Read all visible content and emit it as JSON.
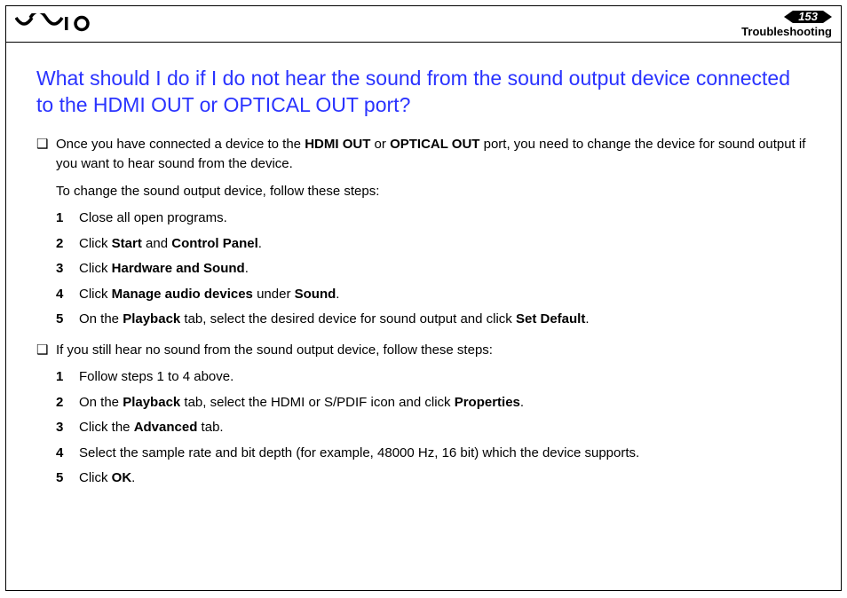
{
  "header": {
    "page_number": "153",
    "section": "Troubleshooting"
  },
  "title": "What should I do if I do not hear the sound from the sound output device connected to the HDMI OUT or OPTICAL OUT port?",
  "bullets": [
    {
      "intro_pre": "Once you have connected a device to the ",
      "bold1": "HDMI OUT",
      "mid1": " or ",
      "bold2": "OPTICAL OUT",
      "intro_post": " port, you need to change the device for sound output if you want to hear sound from the device.",
      "lead": "To change the sound output device, follow these steps:",
      "steps": [
        {
          "n": "1",
          "pre": "Close all open programs.",
          "b1": "",
          "mid": "",
          "b2": "",
          "post": ""
        },
        {
          "n": "2",
          "pre": "Click ",
          "b1": "Start",
          "mid": " and ",
          "b2": "Control Panel",
          "post": "."
        },
        {
          "n": "3",
          "pre": "Click ",
          "b1": "Hardware and Sound",
          "mid": "",
          "b2": "",
          "post": "."
        },
        {
          "n": "4",
          "pre": "Click ",
          "b1": "Manage audio devices",
          "mid": " under ",
          "b2": "Sound",
          "post": "."
        },
        {
          "n": "5",
          "pre": "On the ",
          "b1": "Playback",
          "mid": " tab, select the desired device for sound output and click ",
          "b2": "Set Default",
          "post": "."
        }
      ]
    },
    {
      "intro_pre": "If you still hear no sound from the sound output device, follow these steps:",
      "bold1": "",
      "mid1": "",
      "bold2": "",
      "intro_post": "",
      "lead": "",
      "steps": [
        {
          "n": "1",
          "pre": "Follow steps 1 to 4 above.",
          "b1": "",
          "mid": "",
          "b2": "",
          "post": ""
        },
        {
          "n": "2",
          "pre": "On the ",
          "b1": "Playback",
          "mid": " tab, select the HDMI or S/PDIF icon and click ",
          "b2": "Properties",
          "post": "."
        },
        {
          "n": "3",
          "pre": "Click the ",
          "b1": "Advanced",
          "mid": "",
          "b2": "",
          "post": " tab."
        },
        {
          "n": "4",
          "pre": "Select the sample rate and bit depth (for example, 48000 Hz, 16 bit) which the device supports.",
          "b1": "",
          "mid": "",
          "b2": "",
          "post": ""
        },
        {
          "n": "5",
          "pre": "Click ",
          "b1": "OK",
          "mid": "",
          "b2": "",
          "post": "."
        }
      ]
    }
  ]
}
